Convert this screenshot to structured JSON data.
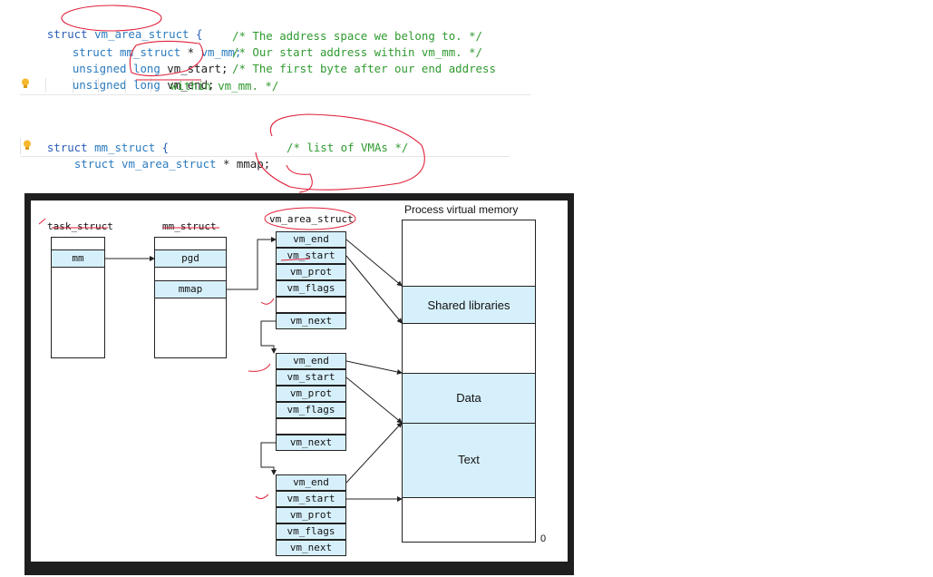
{
  "code_block_1": {
    "line1": {
      "kw": "struct ",
      "name": "vm_area_struct",
      "brace": " {"
    },
    "line2": {
      "type": "struct mm_struct",
      "star": " * ",
      "var": "vm_mm;",
      "comment": "/* The address space we belong to. */"
    },
    "line3": {
      "type": "unsigned long ",
      "var": "vm_start;",
      "comment": "/* Our start address within vm_mm. */"
    },
    "line4": {
      "type": "unsigned long ",
      "var": "vm_end;",
      "comment": "/* The first byte after our end address"
    },
    "line5": {
      "comment": "within vm_mm. */"
    }
  },
  "code_block_2": {
    "line1": {
      "kw": "struct ",
      "name": "mm_struct",
      "brace": " {"
    },
    "line2": {
      "type": "struct vm_area_struct",
      "star": " * ",
      "var": "mmap;",
      "comment": "/* list of VMAs */"
    }
  },
  "diagram": {
    "task_struct_label": "task_struct",
    "mm_struct_label": "mm_struct",
    "vm_area_struct_label": "vm_area_struct",
    "process_vm_label": "Process virtual memory",
    "task_field": "mm",
    "mm_fields": [
      "pgd",
      "mmap"
    ],
    "vma_fields": [
      "vm_end",
      "vm_start",
      "vm_prot",
      "vm_flags",
      "vm_next"
    ],
    "segments": [
      "Shared libraries",
      "Data",
      "Text"
    ],
    "zero_label": "0"
  },
  "colors": {
    "cell_fill": "#d6f0fb",
    "annotation": "#e0203a",
    "keyword": "#2b5fb8",
    "comment": "#2f9a2f"
  }
}
